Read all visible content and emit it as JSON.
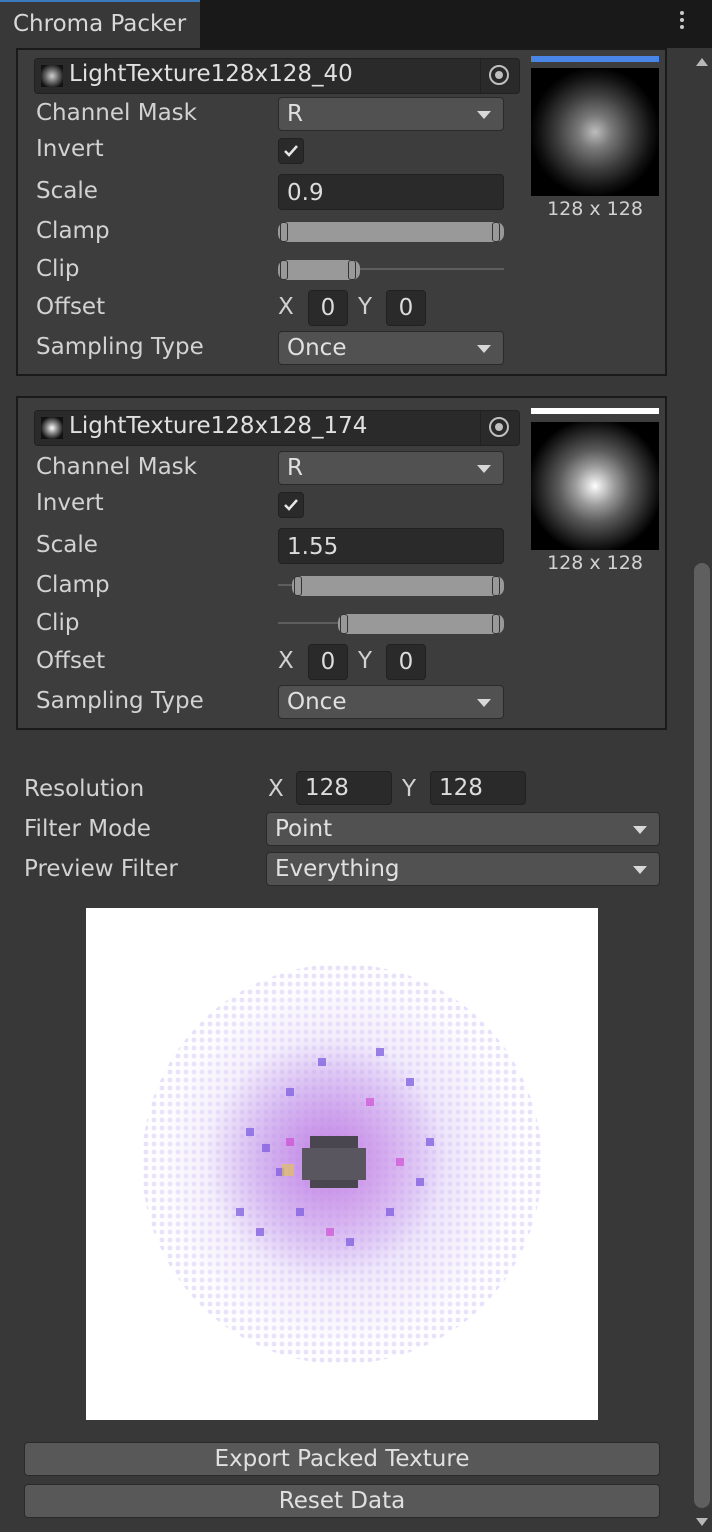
{
  "window": {
    "tab_title": "Chroma Packer"
  },
  "channels": [
    {
      "texture_name": "LightTexture128x128_40",
      "labels": {
        "channel_mask": "Channel Mask",
        "invert": "Invert",
        "scale": "Scale",
        "clamp": "Clamp",
        "clip": "Clip",
        "offset": "Offset",
        "sampling_type": "Sampling Type"
      },
      "channel_mask": "R",
      "invert": true,
      "scale": "0.9",
      "offset_x": "0",
      "offset_y": "0",
      "sampling_type": "Once",
      "preview_size": "128 x 128",
      "accent_color": "#4a86e8"
    },
    {
      "texture_name": "LightTexture128x128_174",
      "labels": {
        "channel_mask": "Channel Mask",
        "invert": "Invert",
        "scale": "Scale",
        "clamp": "Clamp",
        "clip": "Clip",
        "offset": "Offset",
        "sampling_type": "Sampling Type"
      },
      "channel_mask": "R",
      "invert": true,
      "scale": "1.55",
      "offset_x": "0",
      "offset_y": "0",
      "sampling_type": "Once",
      "preview_size": "128 x 128",
      "accent_color": "#ffffff"
    }
  ],
  "axis": {
    "x": "X",
    "y": "Y"
  },
  "settings": {
    "resolution_label": "Resolution",
    "resolution_x": "128",
    "resolution_y": "128",
    "filter_mode_label": "Filter Mode",
    "filter_mode": "Point",
    "preview_filter_label": "Preview Filter",
    "preview_filter": "Everything"
  },
  "actions": {
    "export_label": "Export Packed Texture",
    "reset_label": "Reset Data"
  }
}
